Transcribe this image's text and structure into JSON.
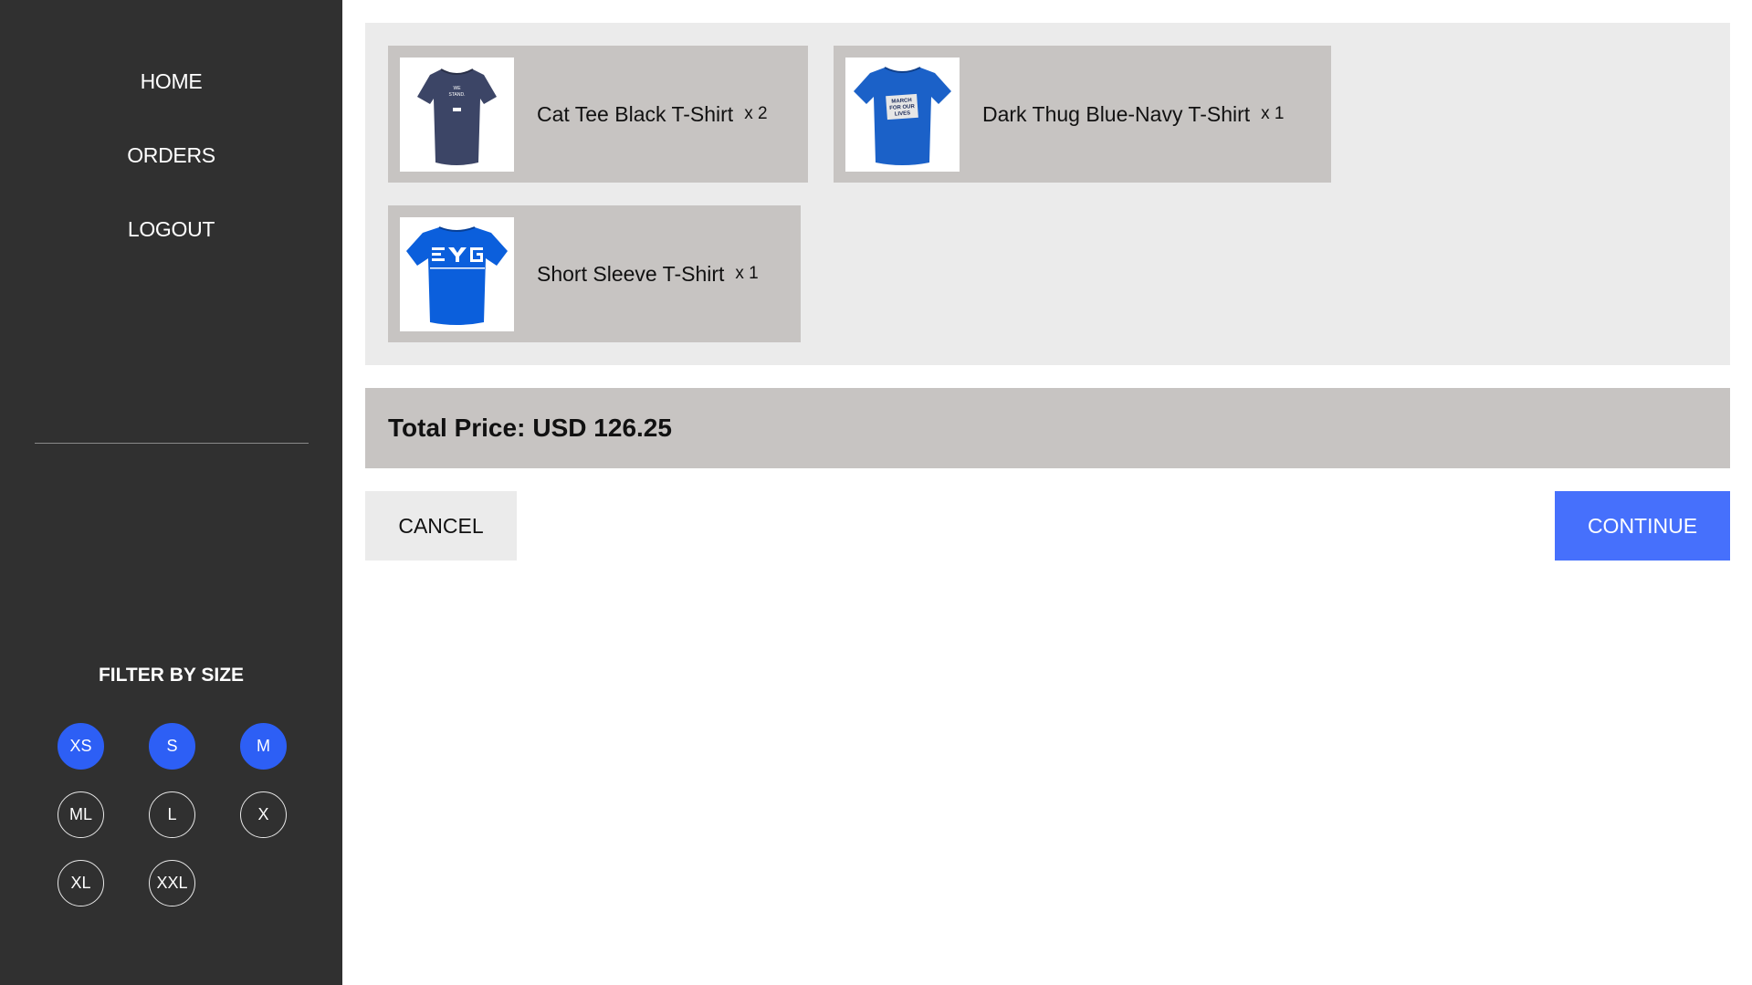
{
  "sidebar": {
    "nav": [
      {
        "label": "HOME"
      },
      {
        "label": "ORDERS"
      },
      {
        "label": "LOGOUT"
      }
    ],
    "filter_title": "FILTER BY SIZE",
    "sizes": [
      {
        "label": "XS",
        "active": true
      },
      {
        "label": "S",
        "active": true
      },
      {
        "label": "M",
        "active": true
      },
      {
        "label": "ML",
        "active": false
      },
      {
        "label": "L",
        "active": false
      },
      {
        "label": "X",
        "active": false
      },
      {
        "label": "XL",
        "active": false
      },
      {
        "label": "XXL",
        "active": false
      }
    ]
  },
  "cart": {
    "items": [
      {
        "name": "Cat Tee Black T-Shirt",
        "qty": "x 2",
        "image": "navy-tshirt-image"
      },
      {
        "name": "Dark Thug Blue-Navy T-Shirt",
        "qty": "x 1",
        "image": "blue-tshirt-image"
      },
      {
        "name": "Short Sleeve T-Shirt",
        "qty": "x 1",
        "image": "blue-tshirt-image"
      }
    ]
  },
  "total": {
    "label": "Total Price:",
    "value": "USD 126.25"
  },
  "actions": {
    "cancel_label": "CANCEL",
    "continue_label": "CONTINUE"
  },
  "colors": {
    "sidebar_bg": "#303030",
    "accent": "#4670fc",
    "active_size": "#2d5ff5",
    "item_bg": "#c7c4c2",
    "panel_bg": "#ebebeb"
  }
}
